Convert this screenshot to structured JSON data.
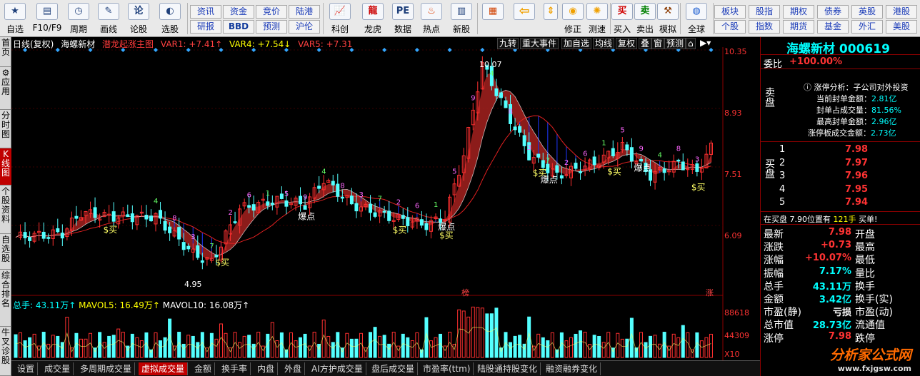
{
  "toolbar": {
    "items": [
      {
        "label": "自选",
        "icon": "star-icon"
      },
      {
        "label": "F10/F9",
        "icon": "f10-icon"
      },
      {
        "label": "周期",
        "icon": "clock-icon"
      },
      {
        "label": "画线",
        "icon": "pencil-icon"
      },
      {
        "label": "论股",
        "icon": "discuss-icon"
      },
      {
        "label": "选股",
        "icon": "chart-search-icon"
      }
    ],
    "grid_buttons": [
      [
        "资讯",
        "资金",
        "竞价",
        "陆港"
      ],
      [
        "研报",
        "BBD",
        "预测",
        "沪伦"
      ]
    ],
    "items2": [
      {
        "label": "科创",
        "icon": "kechuang-icon"
      },
      {
        "label": "龙虎",
        "icon": "dragon-tiger-icon"
      },
      {
        "label": "数据",
        "icon": "pe-data-icon"
      },
      {
        "label": "热点",
        "icon": "hot-icon"
      },
      {
        "label": "新股",
        "icon": "new-stock-icon"
      }
    ],
    "items3": [
      {
        "label": "",
        "icon": "layout-icon"
      },
      {
        "label": "",
        "icon": "back-arrow-icon"
      },
      {
        "label": "",
        "icon": "up-down-icon"
      },
      {
        "label": "修正",
        "icon": "fix-icon"
      },
      {
        "label": "测速",
        "icon": "speed-icon"
      },
      {
        "label": "买入",
        "icon": "buy-icon"
      },
      {
        "label": "卖出",
        "icon": "sell-icon"
      },
      {
        "label": "模拟",
        "icon": "simulate-icon"
      },
      {
        "label": "全球",
        "icon": "globe-icon"
      }
    ],
    "grid_buttons2": [
      [
        "板块",
        "股指",
        "期权",
        "债券",
        "英股",
        "港股"
      ],
      [
        "个股",
        "指数",
        "期货",
        "基金",
        "外汇",
        "美股"
      ]
    ]
  },
  "left_tabs": [
    "首页",
    "应用",
    "分时图",
    "K线图",
    "个股资料",
    "自选股",
    "综合排名",
    "牛叉诊股"
  ],
  "chart_header": {
    "mode": "日线(复权)",
    "stock_name": "海螺新材",
    "indicator": "潜龙起涨主图",
    "var1": "VAR1: +7.41↑",
    "var4": "VAR4: +7.54↓",
    "var5": "VAR5: +7.31"
  },
  "chart_tools": [
    "九转",
    "重大事件",
    "加自选",
    "均线",
    "复权",
    "叠",
    "窗",
    "预测"
  ],
  "price_axis": [
    "10.35",
    "8.93",
    "7.51",
    "6.09"
  ],
  "volume_axis": [
    "88618",
    "44309",
    "X10"
  ],
  "annotations": {
    "high": "10.07",
    "low": "4.95",
    "buy": "$买",
    "burst": "爆点",
    "bang": "榜",
    "zhang": "涨"
  },
  "volume_header": {
    "total": "总手: 43.11万↑",
    "mavol5": "MAVOL5: 16.49万↑",
    "mavol10": "MAVOL10: 16.08万↑"
  },
  "bottom_tabs": [
    "设置",
    "成交量",
    "多周期成交量",
    "虚拟成交量",
    "金额",
    "换手率",
    "内盘",
    "外盘",
    "AI方护成交量",
    "盘后成交量",
    "市盈率(ttm)",
    "陆股通持股变化",
    "融资融券变化"
  ],
  "panel": {
    "title": "海螺新材",
    "code": "000619",
    "webi_label": "委比",
    "webi_value": "+100.00%",
    "limit_analysis": "涨停分析：子公司对外投资",
    "limit_rows": [
      {
        "label": "当前封单金额：",
        "value": "2.81亿"
      },
      {
        "label": "封单占成交量：",
        "value": "81.56%"
      },
      {
        "label": "最高封单金额：",
        "value": "2.96亿"
      },
      {
        "label": "涨停板成交金额：",
        "value": "2.73亿"
      }
    ],
    "sell_label": "卖盘",
    "buy_label": "买盘",
    "bids": [
      {
        "level": "1",
        "price": "7.98"
      },
      {
        "level": "2",
        "price": "7.97"
      },
      {
        "level": "3",
        "price": "7.96"
      },
      {
        "level": "4",
        "price": "7.95"
      },
      {
        "level": "5",
        "price": "7.94"
      }
    ],
    "bid_status": "在买盘 7.90位置有",
    "bid_status_vol": "121手",
    "bid_status_action": "买单!",
    "stats_left": [
      {
        "label": "最新",
        "value": "7.98"
      },
      {
        "label": "涨跌",
        "value": "+0.73"
      },
      {
        "label": "涨幅",
        "value": "+10.07%"
      },
      {
        "label": "振幅",
        "value": "7.17%"
      },
      {
        "label": "总手",
        "value": "43.11万"
      },
      {
        "label": "金额",
        "value": "3.42亿"
      },
      {
        "label": "市盈(静)",
        "value": "亏损"
      },
      {
        "label": "总市值",
        "value": "28.73亿"
      },
      {
        "label": "涨停",
        "value": "7.98"
      }
    ],
    "stats_right": [
      "开盘",
      "最高",
      "最低",
      "量比",
      "换手",
      "换手(实)",
      "市盈(动)",
      "流通值",
      "跌停"
    ],
    "brand": "分析家公式网",
    "brand_url": "www.fxjgsw.com"
  },
  "colors": {
    "up": "#ff3333",
    "down": "#00ffff",
    "accent": "#c00000"
  }
}
